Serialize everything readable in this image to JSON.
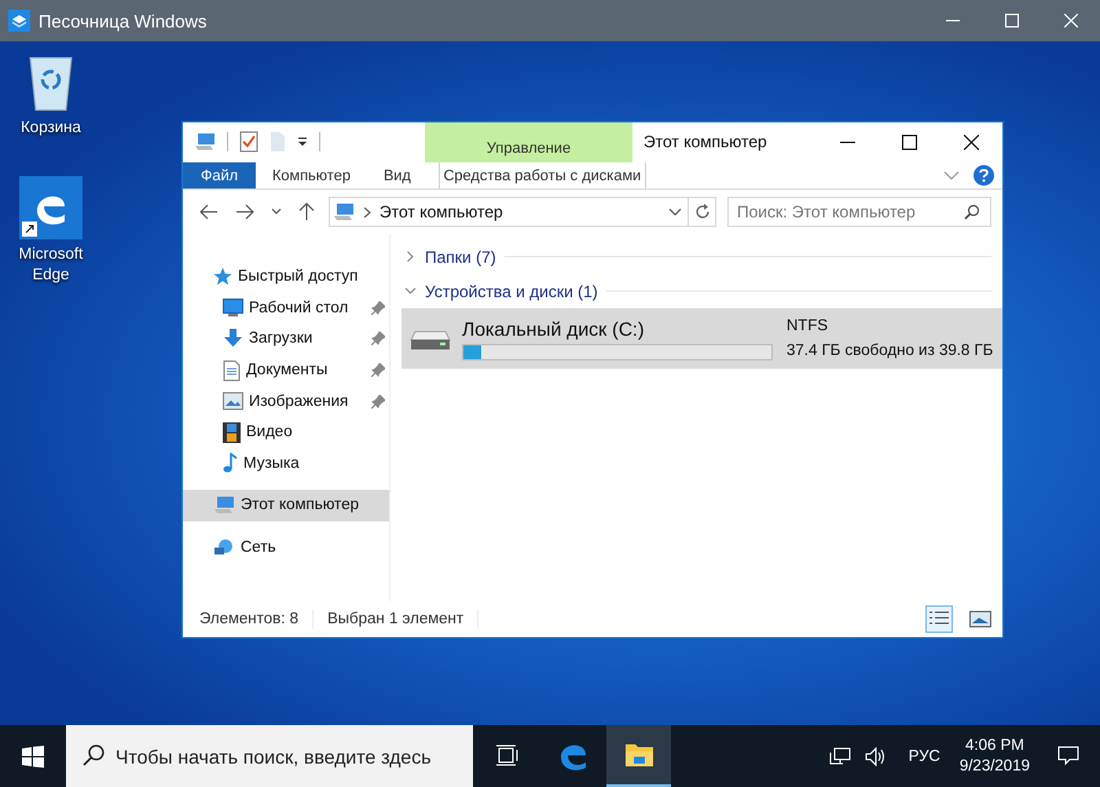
{
  "window": {
    "title": "Песочница Windows"
  },
  "desktop_icons": [
    {
      "label": "Корзина"
    },
    {
      "label": "Microsoft Edge"
    }
  ],
  "explorer": {
    "title": "Этот компьютер",
    "ribbon": {
      "context_group": "Управление",
      "tabs": [
        {
          "label": "Файл",
          "kind": "file"
        },
        {
          "label": "Компьютер",
          "kind": "tab"
        },
        {
          "label": "Вид",
          "kind": "tab"
        },
        {
          "label": "Средства работы с дисками",
          "kind": "context"
        }
      ]
    },
    "address": {
      "path": "Этот компьютер",
      "search_placeholder": "Поиск: Этот компьютер"
    },
    "nav": [
      {
        "label": "Быстрый доступ",
        "selected": false,
        "children": [
          {
            "label": "Рабочий стол",
            "pinned": true,
            "selected": false
          },
          {
            "label": "Загрузки",
            "pinned": true,
            "selected": false
          },
          {
            "label": "Документы",
            "pinned": true,
            "selected": false
          },
          {
            "label": "Изображения",
            "pinned": true,
            "selected": false
          },
          {
            "label": "Видео",
            "pinned": false,
            "selected": false
          },
          {
            "label": "Музыка",
            "pinned": false,
            "selected": false
          }
        ]
      },
      {
        "label": "Этот компьютер",
        "selected": true
      },
      {
        "label": "Сеть",
        "selected": false
      }
    ],
    "groups": [
      {
        "title": "Папки (7)",
        "expanded": false
      },
      {
        "title": "Устройства и диски (1)",
        "expanded": true,
        "items": [
          {
            "name": "Локальный диск (C:)",
            "level": 0.06,
            "filesystem": "NTFS",
            "space": "37.4 ГБ свободно из 39.8 ГБ",
            "selected": true
          }
        ]
      }
    ],
    "status": {
      "count": "Элементов: 8",
      "selection": "Выбран 1 элемент",
      "views": [
        {
          "selected": true
        },
        {
          "selected": false
        }
      ]
    }
  },
  "taskbar": {
    "search_placeholder": "Чтобы начать поиск, введите здесь",
    "apps": [
      {
        "active": false
      },
      {
        "active": false
      },
      {
        "active": true
      }
    ],
    "language": "РУС",
    "time": "4:06 PM",
    "date": "9/23/2019"
  }
}
